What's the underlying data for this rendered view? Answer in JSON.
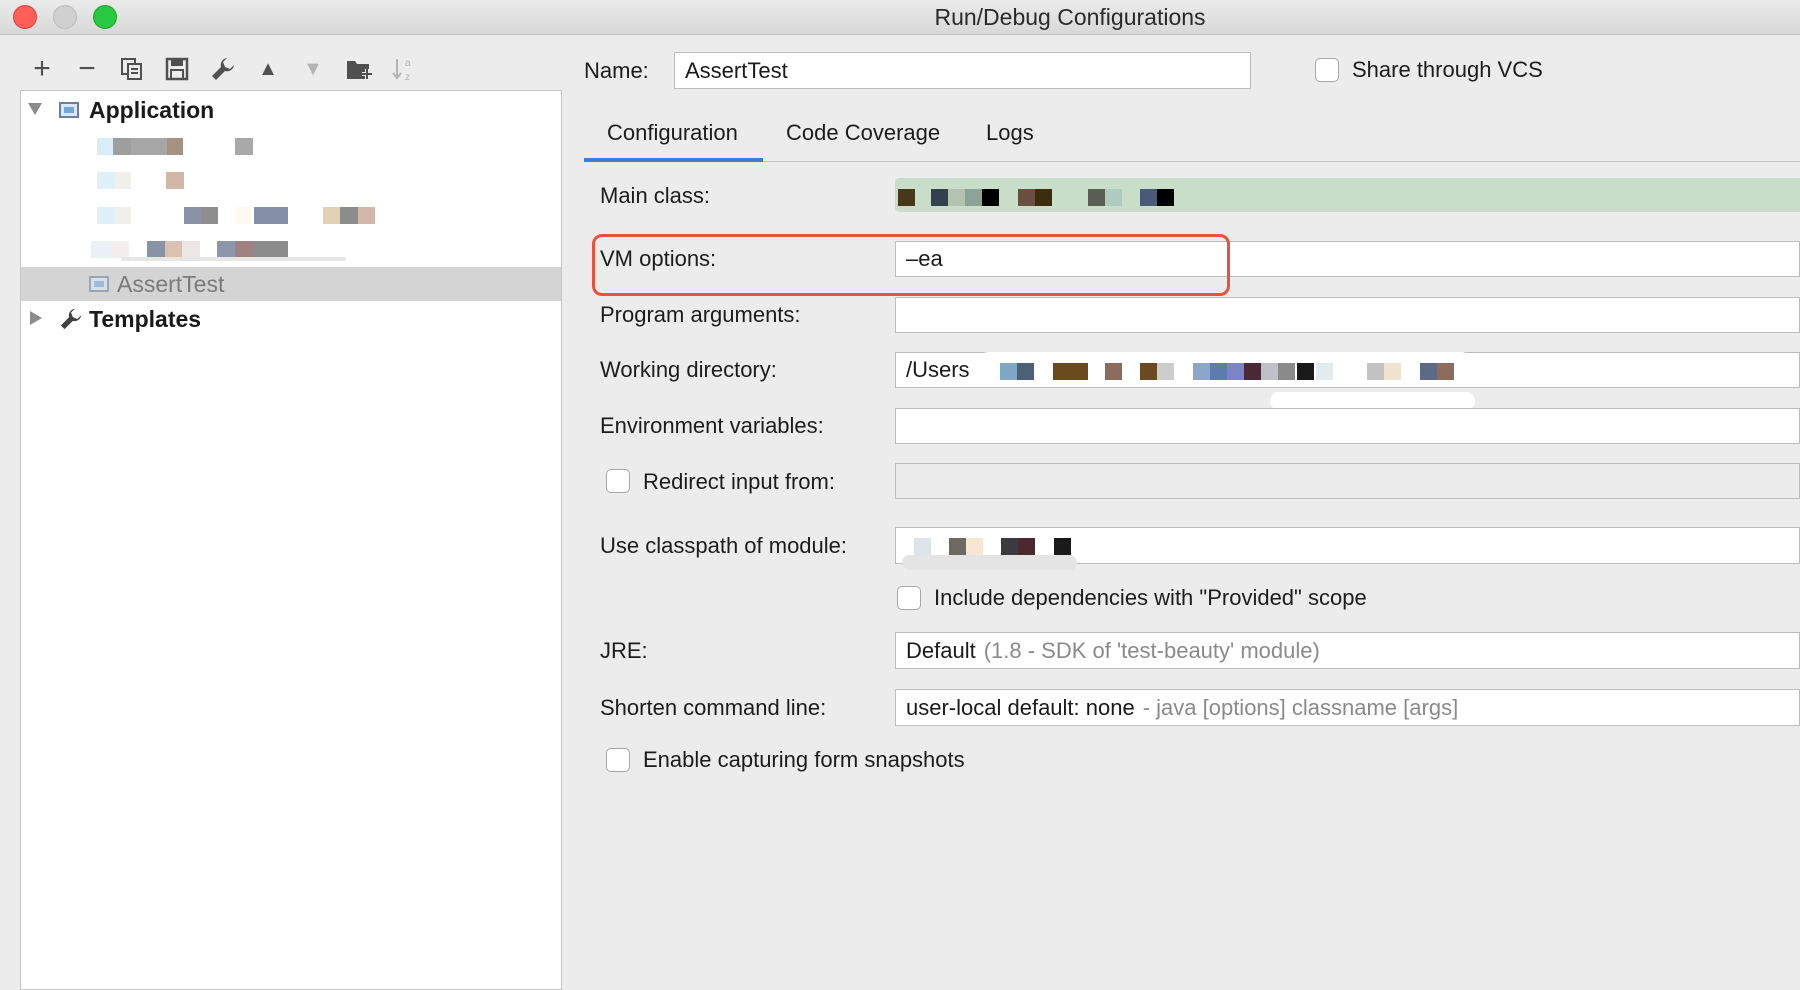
{
  "window": {
    "title": "Run/Debug Configurations"
  },
  "toolbar": {
    "icons": [
      "add-icon",
      "remove-icon",
      "copy-icon",
      "save-icon",
      "wrench-icon",
      "move-up-icon",
      "move-down-icon",
      "new-folder-icon",
      "sort-az-icon"
    ],
    "glyphs": {
      "add": "+",
      "remove": "−",
      "up": "▲",
      "down": "▼"
    }
  },
  "tree": {
    "application_label": "Application",
    "selected_item_label": "AssertTest",
    "templates_label": "Templates"
  },
  "form": {
    "name_label": "Name:",
    "name_value": "AssertTest",
    "share_vcs_label": "Share through VCS",
    "tabs": [
      "Configuration",
      "Code Coverage",
      "Logs"
    ],
    "active_tab": "Configuration",
    "main_class_label": "Main class:",
    "vm_options_label": "VM options:",
    "vm_options_value": "–ea",
    "program_args_label": "Program arguments:",
    "working_dir_label": "Working directory:",
    "working_dir_value_visible": "/Users",
    "env_vars_label": "Environment variables:",
    "redirect_input_label": "Redirect input from:",
    "classpath_label": "Use classpath of module:",
    "include_deps_label": "Include dependencies with \"Provided\" scope",
    "jre_label": "JRE:",
    "jre_value": "Default",
    "jre_hint": "(1.8 - SDK of 'test-beauty' module)",
    "shorten_label": "Shorten command line:",
    "shorten_value": "user-local default: none",
    "shorten_hint": "- java [options] classname [args]",
    "capture_snapshots_label": "Enable capturing form snapshots"
  },
  "colors": {
    "accent": "#3d7dd8",
    "highlight_border": "#e8533a",
    "selection": "#d4d4d4"
  }
}
